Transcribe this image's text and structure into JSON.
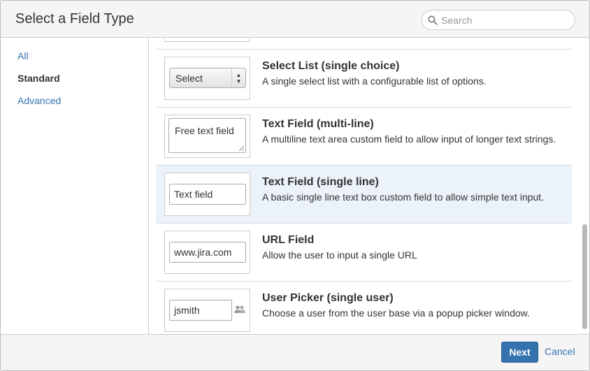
{
  "dialog": {
    "title": "Select a Field Type"
  },
  "search": {
    "placeholder": "Search",
    "value": ""
  },
  "sidebar": {
    "items": [
      {
        "label": "All",
        "active": false
      },
      {
        "label": "Standard",
        "active": true
      },
      {
        "label": "Advanced",
        "active": false
      }
    ]
  },
  "fields": [
    {
      "title": "Select List (single choice)",
      "description": "A single select list with a configurable list of options.",
      "preview": "Select",
      "preview_type": "select"
    },
    {
      "title": "Text Field (multi-line)",
      "description": "A multiline text area custom field to allow input of longer text strings.",
      "preview": "Free text field",
      "preview_type": "textarea"
    },
    {
      "title": "Text Field (single line)",
      "description": "A basic single line text box custom field to allow simple text input.",
      "preview": "Text field",
      "preview_type": "input",
      "selected": true
    },
    {
      "title": "URL Field",
      "description": "Allow the user to input a single URL",
      "preview": "www.jira.com",
      "preview_type": "input"
    },
    {
      "title": "User Picker (single user)",
      "description": "Choose a user from the user base via a popup picker window.",
      "preview": "jsmith",
      "preview_type": "user-picker"
    }
  ],
  "footer": {
    "next_label": "Next",
    "cancel_label": "Cancel"
  },
  "colors": {
    "accent": "#3572b0",
    "selected_row": "#ebf2f9",
    "header_bg": "#f5f5f5"
  }
}
